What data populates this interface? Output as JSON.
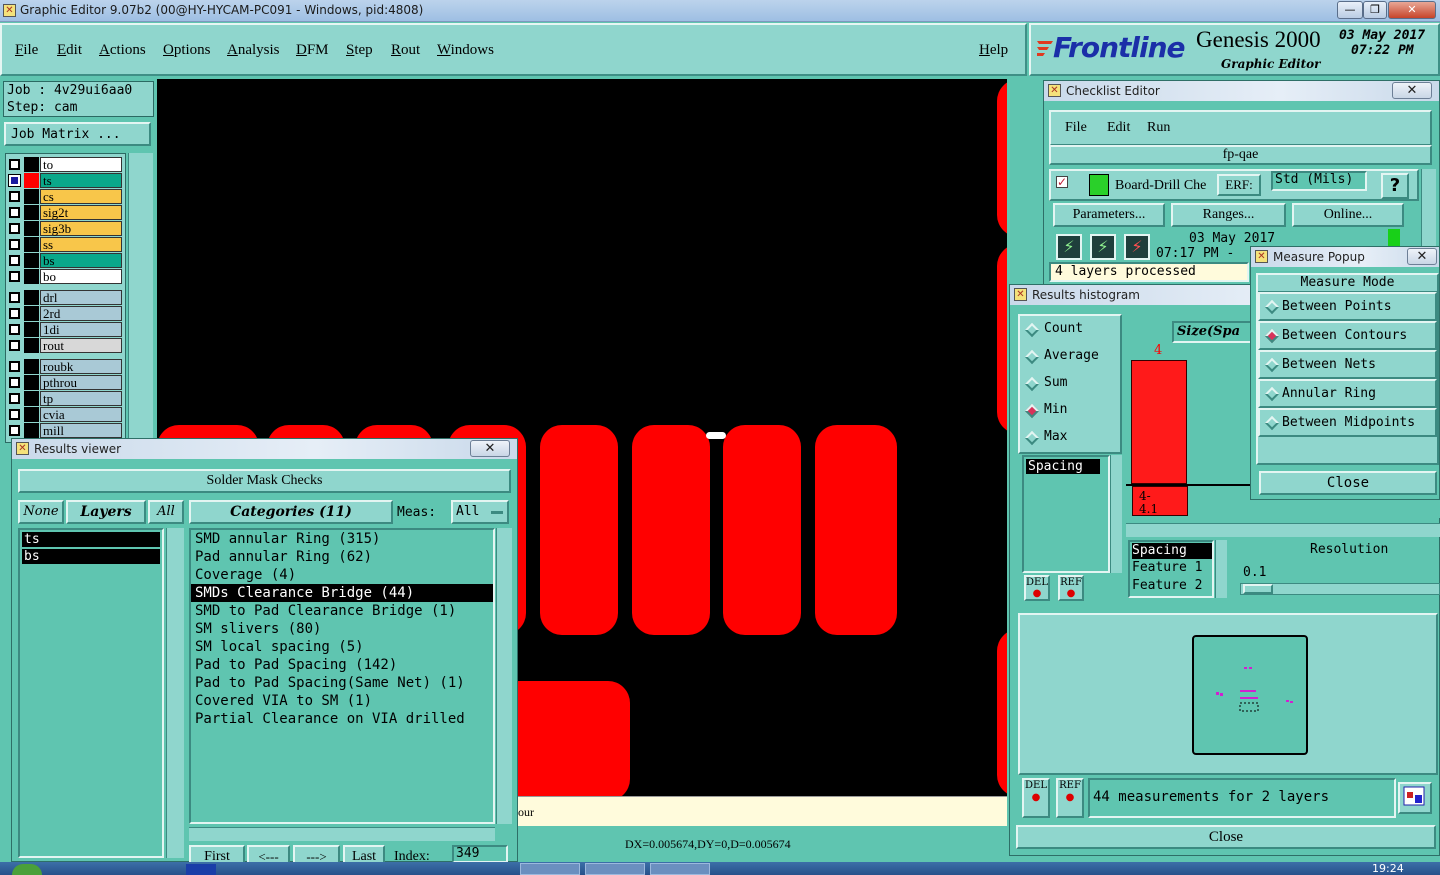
{
  "window": {
    "title": "Graphic Editor 9.07b2 (00@HY-HYCAM-PC091 - Windows, pid:4808)",
    "min": "—",
    "max": "❐",
    "close": "✕"
  },
  "menu": {
    "items": [
      "File",
      "Edit",
      "Actions",
      "Options",
      "Analysis",
      "DFM",
      "Step",
      "Rout",
      "Windows"
    ],
    "help": "Help"
  },
  "logo": {
    "brand": "Frontline",
    "product": "Genesis 2000",
    "subtitle": "Graphic Editor",
    "date": "03 May 2017",
    "time": "07:22 PM"
  },
  "job": {
    "job_line": "Job : 4v29ui6aa0",
    "step_line": "Step: cam",
    "matrix_button": "Job Matrix ..."
  },
  "layers": [
    {
      "name": "to",
      "color": "#ffffff",
      "selected": false
    },
    {
      "name": "ts",
      "color": "#0aa88a",
      "selected": true,
      "swatch": "#ff0000"
    },
    {
      "name": "cs",
      "color": "#f8c64a",
      "selected": false
    },
    {
      "name": "sig2t",
      "color": "#f8c64a",
      "selected": false
    },
    {
      "name": "sig3b",
      "color": "#f8c64a",
      "selected": false
    },
    {
      "name": "ss",
      "color": "#f8c64a",
      "selected": false
    },
    {
      "name": "bs",
      "color": "#0aa88a",
      "selected": false
    },
    {
      "name": "bo",
      "color": "#ffffff",
      "selected": false
    },
    {
      "name": "drl",
      "color": "#a9c9d6",
      "selected": false
    },
    {
      "name": "2rd",
      "color": "#a9c9d6",
      "selected": false
    },
    {
      "name": "1di",
      "color": "#a9c9d6",
      "selected": false
    },
    {
      "name": "rout",
      "color": "#d8d8d8",
      "selected": false
    },
    {
      "name": "roubk",
      "color": "#a9c9d6",
      "selected": false
    },
    {
      "name": "pthrou",
      "color": "#a9c9d6",
      "selected": false
    },
    {
      "name": "tp",
      "color": "#a9c9d6",
      "selected": false
    },
    {
      "name": "cvia",
      "color": "#a9c9d6",
      "selected": false
    },
    {
      "name": "mill",
      "color": "#a9c9d6",
      "selected": false
    }
  ],
  "results_viewer": {
    "title": "Results viewer",
    "header": "Solder Mask Checks",
    "none_btn": "None",
    "layers_btn": "Layers",
    "all_btn": "All",
    "layers": [
      "ts",
      "bs"
    ],
    "categories_btn": "Categories (11)",
    "meas_label": "Meas:",
    "meas_value": "All",
    "categories": [
      "SMD annular Ring (315)",
      "Pad annular Ring (62)",
      "Coverage (4)",
      "SMDs Clearance Bridge (44)",
      "SMD to Pad Clearance Bridge (1)",
      "SM slivers (80)",
      "SM local spacing (5)",
      "Pad to Pad Spacing (142)",
      "Pad to Pad Spacing(Same Net) (1)",
      "Covered VIA to SM (1)",
      "Partial Clearance on VIA drilled"
    ],
    "selected_index": 3,
    "nav": {
      "first": "First",
      "prev": "<---",
      "next": "--->",
      "last": "Last",
      "index_label": "Index:",
      "index_value": "349"
    }
  },
  "checklist": {
    "title": "Checklist Editor",
    "menu": [
      "File",
      "Edit",
      "Run"
    ],
    "name": "fp-qae",
    "check_name": "Board-Drill Che",
    "erf_label": "ERF:",
    "erf_value": "Std (Mils)",
    "help": "?",
    "buttons": [
      "Parameters...",
      "Ranges...",
      "Online..."
    ],
    "date": "03 May 2017",
    "time": "07:17 PM -",
    "status": "4 layers processed"
  },
  "histogram": {
    "title": "Results histogram",
    "modes": [
      "Count",
      "Average",
      "Sum",
      "Min",
      "Max"
    ],
    "selected_mode": "Min",
    "size_label": "Size(Spa",
    "bar_label": "4",
    "bar_range": "4-\n4.1",
    "list": [
      "Spacing"
    ],
    "del": "DEL",
    "ref": "REF",
    "info": [
      "Spacing",
      "Feature 1",
      "Feature 2"
    ],
    "resolution_label": "Resolution",
    "resolution_value": "0.1",
    "measurements": "44 measurements for 2 layers",
    "close": "Close",
    "chart_data": {
      "type": "bar",
      "categories": [
        "4-4.1"
      ],
      "values": [
        4
      ]
    }
  },
  "measure": {
    "title": "Measure Popup",
    "header": "Measure Mode",
    "modes": [
      "Between Points",
      "Between Contours",
      "Between Nets",
      "Annular Ring",
      "Between Midpoints"
    ],
    "selected_mode": "Between Contours",
    "close": "Close"
  },
  "status": {
    "prompt": "our",
    "coords": "DX=0.005674,DY=0,D=0.005674"
  },
  "taskbar": {
    "clock": "19:24"
  }
}
